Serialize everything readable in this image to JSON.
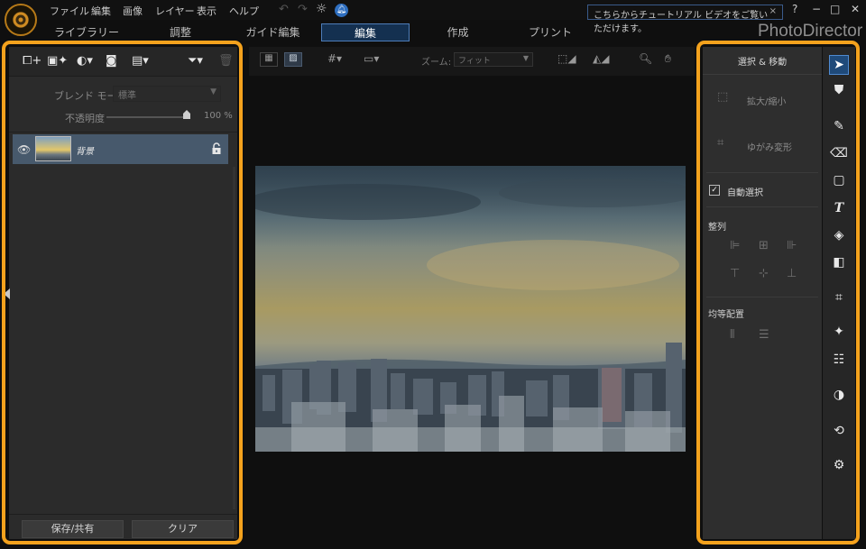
{
  "app": {
    "brand": "PhotoDirector",
    "menu": [
      "ファイル",
      "編集",
      "画像",
      "レイヤー",
      "表示",
      "ヘルプ"
    ],
    "tutorial_banner": "こちらからチュートリアル ビデオをご覧いただけます。",
    "tutorial_close": "×",
    "help": "?",
    "window_controls": [
      "−",
      "□",
      "✕"
    ]
  },
  "tabs": [
    "ライブラリー",
    "調整",
    "ガイド編集",
    "編集",
    "作成",
    "プリント"
  ],
  "active_tab": "編集",
  "left_panel": {
    "blend_mode_label": "ブレンド モード:",
    "blend_mode_value": "標準",
    "opacity_label": "不透明度",
    "opacity_value": "100 %",
    "layers": [
      {
        "name": "背景",
        "visible": true,
        "locked": true
      }
    ],
    "save_share_button": "保存/共有",
    "clear_button": "クリア"
  },
  "center": {
    "zoom_label": "ズーム:",
    "zoom_value": "フィット"
  },
  "right_panel": {
    "title": "選択 & 移動",
    "scale_label": "拡大/縮小",
    "distort_label": "ゆがみ変形",
    "auto_select_label": "自動選択",
    "auto_select_checked": true,
    "align_label": "整列",
    "distribute_label": "均等配置"
  },
  "colors": {
    "highlight_outline": "#f4a21d",
    "active_tab_border": "#4e7db8",
    "layer_row": "#47596c"
  }
}
